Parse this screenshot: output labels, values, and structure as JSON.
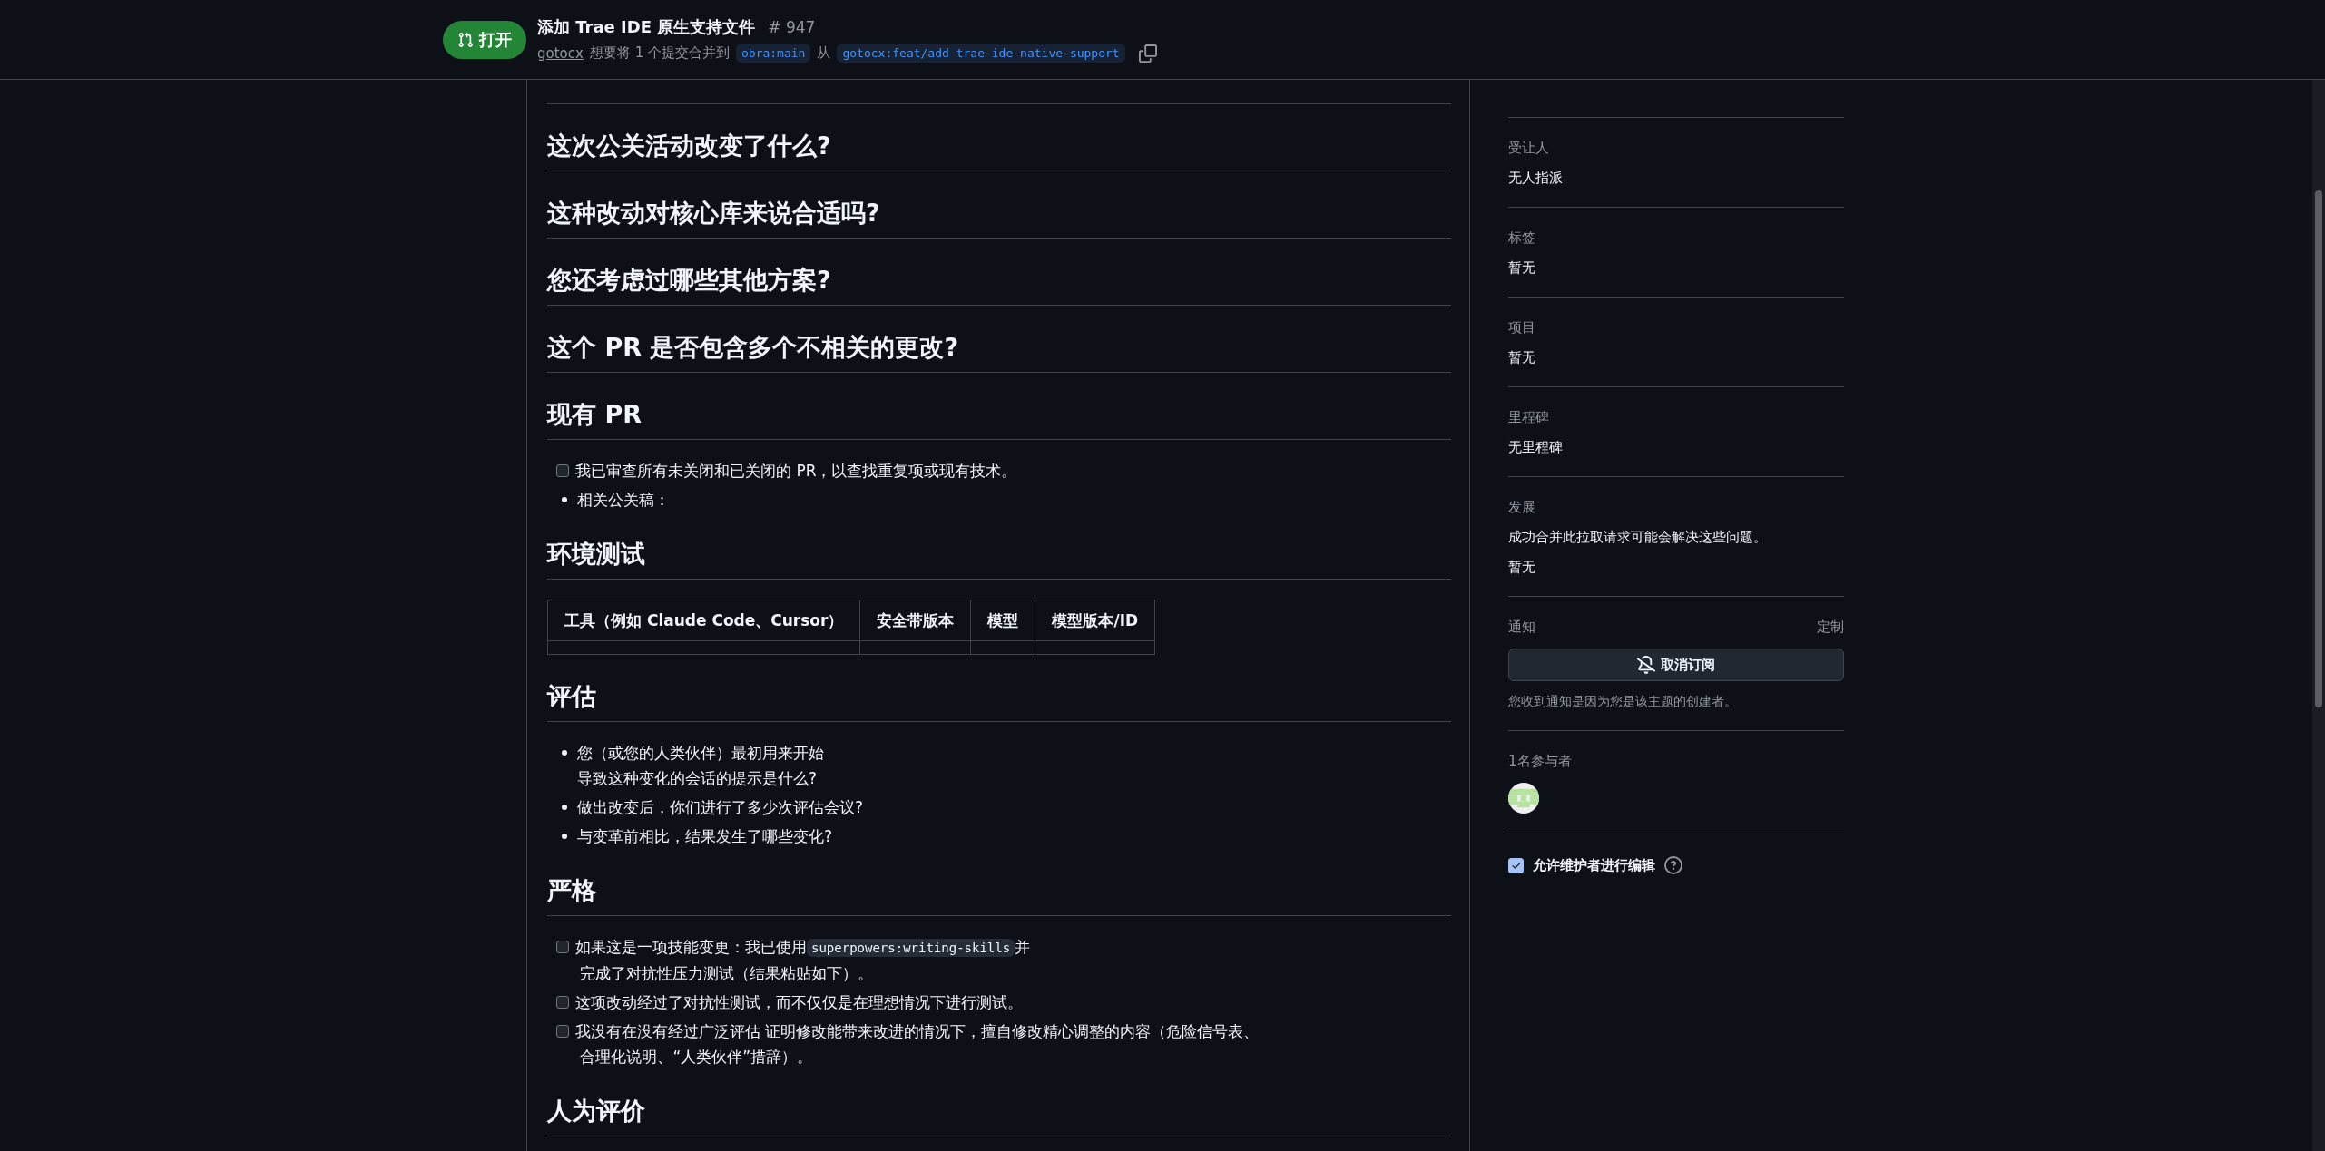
{
  "header": {
    "state": "打开",
    "title": "添加 Trae IDE 原生支持文件",
    "number": "# 947",
    "author": "gotocx",
    "merge_text": "想要将 1 个提交合并到",
    "base_branch": "obra:main",
    "from_word": "从",
    "head_branch": "gotocx:feat/add-trae-ide-native-support"
  },
  "body": [
    {
      "kind": "heading",
      "text": "这次公关活动改变了什么?"
    },
    {
      "kind": "heading",
      "text": "这种改动对核心库来说合适吗?"
    },
    {
      "kind": "heading",
      "text": "您还考虑过哪些其他方案?"
    },
    {
      "kind": "heading",
      "text": "这个 PR 是否包含多个不相关的更改?"
    },
    {
      "kind": "heading",
      "text": "现有 PR"
    },
    {
      "kind": "list",
      "items": [
        {
          "kind": "task",
          "checked": false,
          "lines": [
            [
              {
                "kind": "text",
                "text": "我已审查所有未关闭和已关闭的 PR，以查找重复项或现有技术。"
              }
            ]
          ]
        },
        {
          "kind": "bullet",
          "lines": [
            [
              {
                "kind": "text",
                "text": "相关公关稿："
              }
            ]
          ]
        }
      ]
    },
    {
      "kind": "heading",
      "text": "环境测试"
    },
    {
      "kind": "table",
      "columns": [
        "工具（例如 Claude Code、Cursor）",
        "安全带版本",
        "模型",
        "模型版本/ID"
      ]
    },
    {
      "kind": "heading",
      "text": "评估"
    },
    {
      "kind": "list",
      "items": [
        {
          "kind": "bullet",
          "lines": [
            [
              {
                "kind": "text",
                "text": "您（或您的人类伙伴）最初用来开始"
              }
            ],
            [
              {
                "kind": "text",
                "text": "导致这种变化的会话的提示是什么?"
              }
            ]
          ]
        },
        {
          "kind": "bullet",
          "lines": [
            [
              {
                "kind": "text",
                "text": "做出改变后，你们进行了多少次评估会议?"
              }
            ]
          ]
        },
        {
          "kind": "bullet",
          "lines": [
            [
              {
                "kind": "text",
                "text": "与变革前相比，结果发生了哪些变化?"
              }
            ]
          ]
        }
      ]
    },
    {
      "kind": "heading",
      "text": "严格"
    },
    {
      "kind": "list",
      "items": [
        {
          "kind": "task",
          "checked": false,
          "lines": [
            [
              {
                "kind": "text",
                "text": "如果这是一项技能变更：我已使用"
              },
              {
                "kind": "code",
                "text": "superpowers:writing-skills"
              },
              {
                "kind": "text",
                "text": "并"
              }
            ],
            [
              {
                "kind": "text",
                "text": " 完成了对抗性压力测试（结果粘贴如下）。"
              }
            ]
          ]
        },
        {
          "kind": "task",
          "checked": false,
          "lines": [
            [
              {
                "kind": "text",
                "text": "这项改动经过了对抗性测试，而不仅仅是在理想情况下进行测试。"
              }
            ]
          ]
        },
        {
          "kind": "task",
          "checked": false,
          "lines": [
            [
              {
                "kind": "text",
                "text": "我没有在没有经过广泛评估 证明修改能带来改进的情况下，擅自修改精心调整的内容（危险信号表、"
              }
            ],
            [
              {
                "kind": "text",
                "text": " 合理化说明、“人类伙伴”措辞）。"
              }
            ]
          ]
        }
      ]
    },
    {
      "kind": "heading",
      "text": "人为评价"
    }
  ],
  "sidebar": {
    "sections": [
      {
        "label": "受让人",
        "values": [
          "无人指派"
        ]
      },
      {
        "label": "标签",
        "values": [
          "暂无"
        ]
      },
      {
        "label": "项目",
        "values": [
          "暂无"
        ]
      },
      {
        "label": "里程碑",
        "values": [
          "无里程碑"
        ]
      },
      {
        "label": "发展",
        "values": [
          "成功合并此拉取请求可能会解决这些问题。",
          "暂无"
        ]
      }
    ],
    "notifications": {
      "label": "通知",
      "action": "定制",
      "button": "取消订阅",
      "note": "您收到通知是因为您是该主题的创建者。"
    },
    "participants": {
      "label": "1名参与者"
    },
    "maintainer_edit": {
      "label": "允许维护者进行编辑",
      "checked": true
    }
  }
}
